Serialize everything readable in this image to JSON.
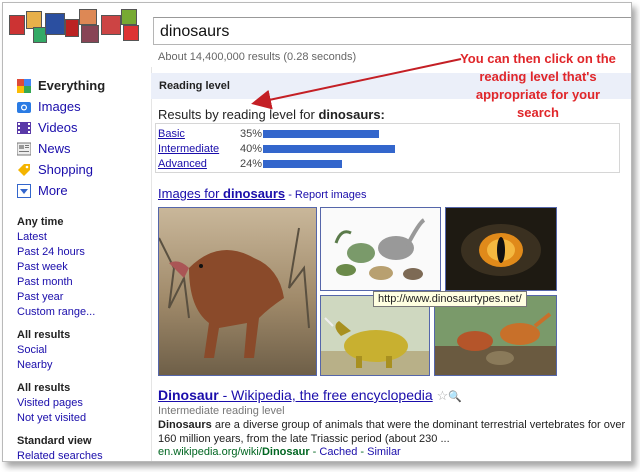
{
  "search": {
    "query": "dinosaurs",
    "stats": "About 14,400,000 results (0.28 seconds)"
  },
  "sidebar": {
    "nav": [
      {
        "label": "Everything",
        "icon": "google-g-icon"
      },
      {
        "label": "Images",
        "icon": "camera-icon"
      },
      {
        "label": "Videos",
        "icon": "film-icon"
      },
      {
        "label": "News",
        "icon": "newspaper-icon"
      },
      {
        "label": "Shopping",
        "icon": "price-tag-icon"
      },
      {
        "label": "More",
        "icon": "dropdown-arrow-icon"
      }
    ],
    "time": {
      "heading": "Any time",
      "items": [
        "Latest",
        "Past 24 hours",
        "Past week",
        "Past month",
        "Past year",
        "Custom range..."
      ]
    },
    "results1": {
      "heading": "All results",
      "items": [
        "Social",
        "Nearby"
      ]
    },
    "results2": {
      "heading": "All results",
      "items": [
        "Visited pages",
        "Not yet visited"
      ]
    },
    "view": {
      "heading": "Standard view",
      "items": [
        "Related searches"
      ]
    }
  },
  "reading_level": {
    "header": "Reading level",
    "title_prefix": "Results by reading level for",
    "title_query": "dinosaurs:",
    "rows": [
      {
        "label": "Basic",
        "pct_text": "35%",
        "value": 35
      },
      {
        "label": "Intermediate",
        "pct_text": "40%",
        "value": 40
      },
      {
        "label": "Advanced",
        "pct_text": "24%",
        "value": 24
      }
    ],
    "bar_color": "#3366cc"
  },
  "images": {
    "title_prefix": "Images for ",
    "title_query": "dinosaurs",
    "report": " - Report images",
    "tooltip": "http://www.dinosaurtypes.net/"
  },
  "result": {
    "title_bold": "Dinosaur",
    "title_rest": " - Wikipedia, the free encyclopedia",
    "reading_level": "Intermediate reading level",
    "snippet_bold": "Dinosaurs",
    "snippet_rest": " are a diverse group of animals that were the dominant terrestrial vertebrates for over 160 million years, from the late Triassic period (about 230 ...",
    "url_prefix": "en.wikipedia.org/wiki/",
    "url_bold": "Dinosaur",
    "cached": "Cached",
    "similar": "Similar",
    "sep": " - "
  },
  "annotation": {
    "text": "You can then click on the reading level that's appropriate for your search",
    "color": "#e0262a"
  }
}
